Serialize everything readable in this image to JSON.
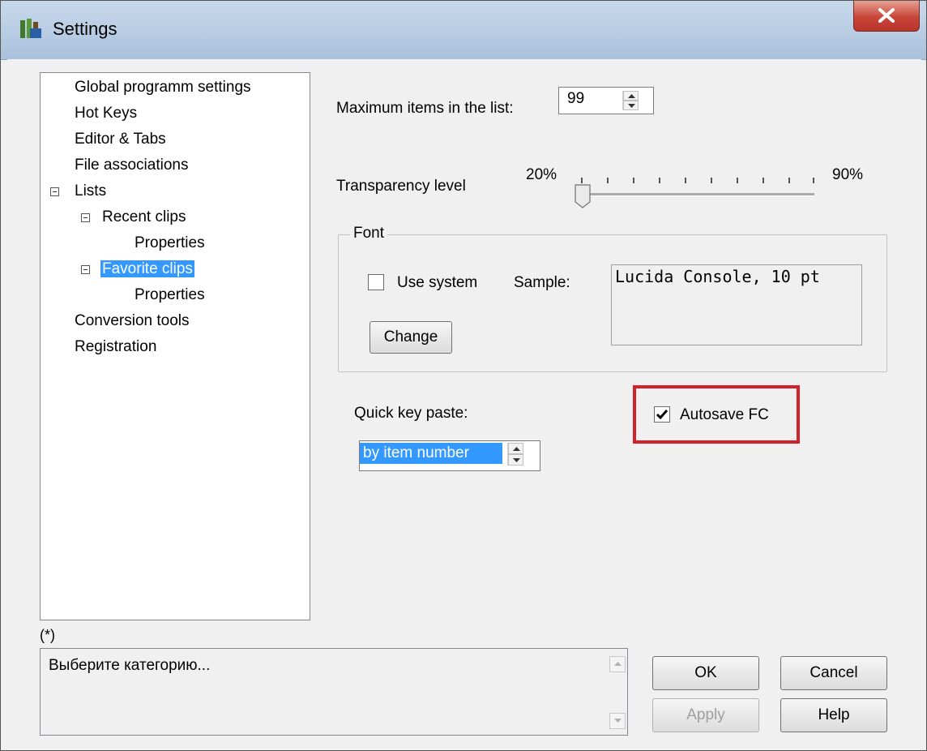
{
  "window": {
    "title": "Settings",
    "app_icon": "tree-app-icon",
    "close_icon": "close-icon"
  },
  "tree": {
    "items": [
      {
        "label": "Global programm settings"
      },
      {
        "label": "Hot Keys"
      },
      {
        "label": "Editor & Tabs"
      },
      {
        "label": "File associations"
      },
      {
        "label": "Lists",
        "expanded": true
      },
      {
        "label": "Recent clips",
        "expanded": true
      },
      {
        "label": "Properties"
      },
      {
        "label": "Favorite clips",
        "expanded": true,
        "selected": true
      },
      {
        "label": "Properties"
      },
      {
        "label": "Conversion tools"
      },
      {
        "label": "Registration"
      }
    ]
  },
  "settings": {
    "max_items_label": "Maximum items in the list:",
    "max_items_value": "99",
    "transparency_label": "Transparency level",
    "transparency_min": "20%",
    "transparency_max": "90%",
    "transparency_value_percent": 20,
    "font_group_label": "Font",
    "use_system_label": "Use system",
    "use_system_checked": false,
    "sample_label": "Sample:",
    "sample_text": "Lucida Console, 10 pt",
    "change_label": "Change",
    "quick_key_label": "Quick key paste:",
    "quick_key_selected": "by item number",
    "autosave_label": "Autosave FC",
    "autosave_checked": true
  },
  "footer": {
    "asterisk": "(*)",
    "description": "Выберите категорию...",
    "ok_label": "OK",
    "cancel_label": "Cancel",
    "apply_label": "Apply",
    "help_label": "Help"
  },
  "colors": {
    "selection": "#3399ff",
    "highlight_border": "#d2232a"
  }
}
